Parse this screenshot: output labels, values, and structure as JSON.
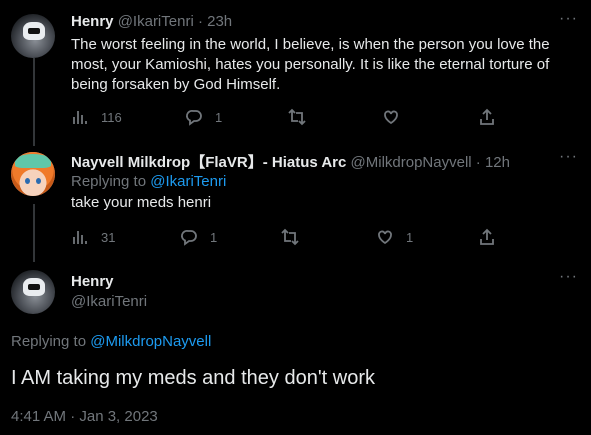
{
  "tweet1": {
    "author_name": "Henry",
    "handle": "@IkariTenri",
    "time": "· 23h",
    "text_lines": [
      "The worst feeling in the world, I believe, is when the person you love the",
      "most, your Kamioshi, hates you personally. It is like the eternal torture of",
      "being forsaken by God Himself."
    ],
    "views": "116",
    "replies": "1"
  },
  "tweet2": {
    "author_name": "Nayvell Milkdrop【FlaVR】- Hiatus Arc",
    "handle": "@MilkdropNayvell",
    "time": "· 12h",
    "replying_label": "Replying to",
    "replying_handle": "@IkariTenri",
    "text": "take your meds henri",
    "views": "31",
    "replies": "1",
    "likes": "1"
  },
  "main": {
    "author_name": "Henry",
    "handle": "@IkariTenri",
    "replying_label": "Replying to",
    "replying_handle": "@MilkdropNayvell",
    "text": "I AM taking my meds and they don't work",
    "timestamp": "4:41 AM · Jan 3, 2023"
  },
  "icons": {
    "views": "views-icon",
    "reply": "reply-icon",
    "retweet": "retweet-icon",
    "like": "like-icon",
    "share": "share-icon",
    "more": "more-icon"
  },
  "colors": {
    "link": "#1d9bf0",
    "muted": "#71767b",
    "text": "#e7e9ea",
    "background": "#000000"
  }
}
